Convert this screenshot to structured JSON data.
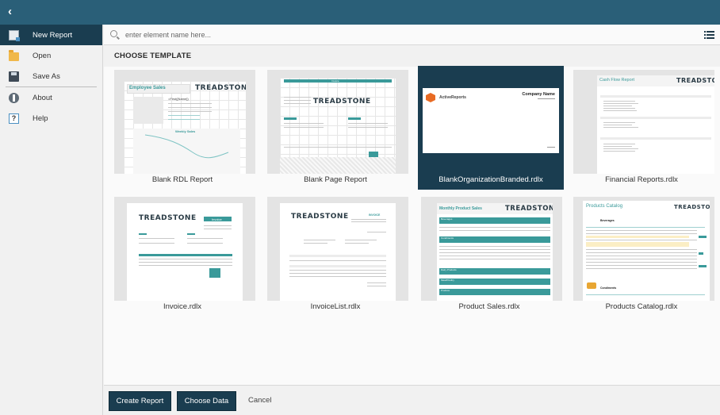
{
  "header": {
    "back_icon": "chevron-left-icon",
    "back_glyph": "‹"
  },
  "sidebar": {
    "items": [
      {
        "label": "New Report",
        "icon": "new-report-icon",
        "active": true
      },
      {
        "label": "Open",
        "icon": "folder-icon"
      },
      {
        "label": "Save As",
        "icon": "floppy-disk-icon"
      },
      {
        "label": "About",
        "icon": "info-icon"
      },
      {
        "label": "Help",
        "icon": "help-icon",
        "glyph": "?"
      }
    ]
  },
  "search": {
    "placeholder": "enter element name here...",
    "value": ""
  },
  "content": {
    "section_title": "CHOOSE TEMPLATE",
    "templates": [
      {
        "label": "Blank RDL Report",
        "thumb_title": "Employee Sales",
        "thumb_logo": "TREADSTONE",
        "thumb_chart_title": "Weekly Sales",
        "thumb_field": "=First([Name])"
      },
      {
        "label": "Blank Page Report",
        "thumb_title": "Invoice",
        "thumb_logo": "TREADSTONE"
      },
      {
        "label": "BlankOrganizationBranded.rdlx",
        "selected": true,
        "thumb_brand": "ActiveReports",
        "thumb_company": "Company Name"
      },
      {
        "label": "Financial Reports.rdlx",
        "thumb_title": "Cash Flow Report",
        "thumb_logo": "TREADSTONE"
      },
      {
        "label": "Invoice.rdlx",
        "thumb_title": "Invoice",
        "thumb_logo": "TREADSTONE"
      },
      {
        "label": "InvoiceList.rdlx",
        "thumb_title": "INVOICE",
        "thumb_logo": "TREADSTONE"
      },
      {
        "label": "Product Sales.rdlx",
        "thumb_title": "Monthly Product Sales",
        "thumb_logo": "TREADSTONE",
        "thumb_sections": [
          "Beverages",
          "Condiments",
          "Dairy Products",
          "Meat/Poultry",
          "Produce"
        ]
      },
      {
        "label": "Products Catalog.rdlx",
        "thumb_title": "Products Catalog",
        "thumb_logo": "TREADSTONE",
        "thumb_sections": [
          "Beverages",
          "Condiments"
        ]
      }
    ]
  },
  "footer": {
    "create_label": "Create Report",
    "choose_data_label": "Choose Data",
    "cancel_label": "Cancel"
  },
  "colors": {
    "header_bg": "#2a5f78",
    "active_bg": "#1a3d50",
    "button_bg": "#1a3d50",
    "accent_teal": "#3a9a9a"
  }
}
